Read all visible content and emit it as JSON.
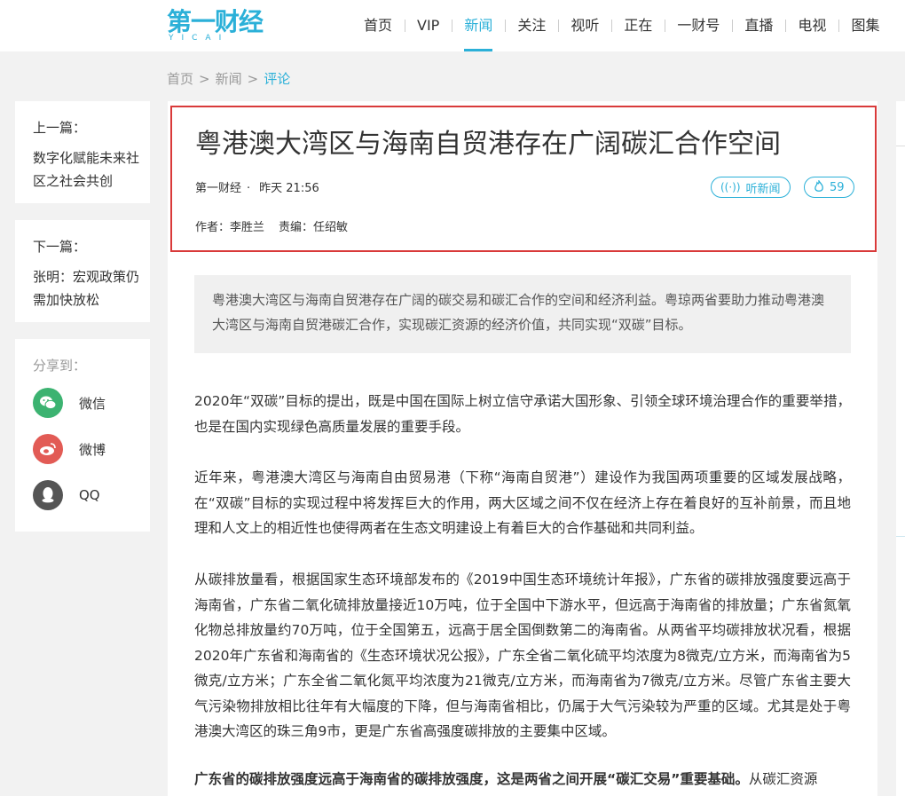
{
  "logo": {
    "main": "第一财经",
    "sub": "YICAI"
  },
  "nav": [
    {
      "label": "首页"
    },
    {
      "label": "VIP"
    },
    {
      "label": "新闻"
    },
    {
      "label": "关注"
    },
    {
      "label": "视听"
    },
    {
      "label": "正在"
    },
    {
      "label": "一财号"
    },
    {
      "label": "直播"
    },
    {
      "label": "电视"
    },
    {
      "label": "图集"
    }
  ],
  "nav_active": "新闻",
  "breadcrumb": {
    "home": "首页",
    "sep1": ">",
    "news": "新闻",
    "sep2": ">",
    "current": "评论"
  },
  "prev": {
    "label": "上一篇：",
    "title": "数字化赋能未来社区之社会共创"
  },
  "next": {
    "label": "下一篇：",
    "title": "张明：宏观政策仍需加快放松"
  },
  "share": {
    "label": "分享到：",
    "items": [
      {
        "label": "微信",
        "icon": "wechat-icon",
        "color": "#3cb371"
      },
      {
        "label": "微博",
        "icon": "weibo-icon",
        "color": "#e25b55"
      },
      {
        "label": "QQ",
        "icon": "qq-icon",
        "color": "#555555"
      }
    ]
  },
  "article": {
    "title": "粤港澳大湾区与海南自贸港存在广阔碳汇合作空间",
    "source": "第一财经",
    "dot": "·",
    "time": "昨天 21:56",
    "listen_label": "听新闻",
    "hot_count": "59",
    "author": "作者：李胜兰",
    "editor": "责编：任绍敏",
    "summary": "粤港澳大湾区与海南自贸港存在广阔的碳交易和碳汇合作的空间和经济利益。粤琼两省要助力推动粤港澳大湾区与海南自贸港碳汇合作，实现碳汇资源的经济价值，共同实现“双碳”目标。",
    "p1": "2020年“双碳”目标的提出，既是中国在国际上树立信守承诺大国形象、引领全球环境治理合作的重要举措，也是在国内实现绿色高质量发展的重要手段。",
    "p2": "近年来，粤港澳大湾区与海南自由贸易港（下称“海南自贸港”）建设作为我国两项重要的区域发展战略，在“双碳”目标的实现过程中将发挥巨大的作用，两大区域之间不仅在经济上存在着良好的互补前景，而且地理和人文上的相近性也使得两者在生态文明建设上有着巨大的合作基础和共同利益。",
    "p3": "从碳排放量看，根据国家生态环境部发布的《2019中国生态环境统计年报》，广东省的碳排放强度要远高于海南省，广东省二氧化硫排放量接近10万吨，位于全国中下游水平，但远高于海南省的排放量；广东省氮氧化物总排放量约70万吨，位于全国第五，远高于居全国倒数第二的海南省。从两省平均碳排放状况看，根据2020年广东省和海南省的《生态环境状况公报》，广东全省二氧化硫平均浓度为8微克/立方米，而海南省为5微克/立方米；广东全省二氧化氮平均浓度为21微克/立方米，而海南省为7微克/立方米。尽管广东省主要大气污染物排放相比往年有大幅度的下降，但与海南省相比，仍属于大气污染较为严重的区域。尤其是处于粤港澳大湾区的珠三角9市，更是广东省高强度碳排放的主要集中区域。",
    "p4_bold": "广东省的碳排放强度远高于海南省的碳排放强度，这是两省之间开展“碳汇交易”重要基础。",
    "p4_rest": "从碳汇资源"
  },
  "colors": {
    "accent": "#2bb0d8",
    "highlight_border": "#d93a3a"
  }
}
